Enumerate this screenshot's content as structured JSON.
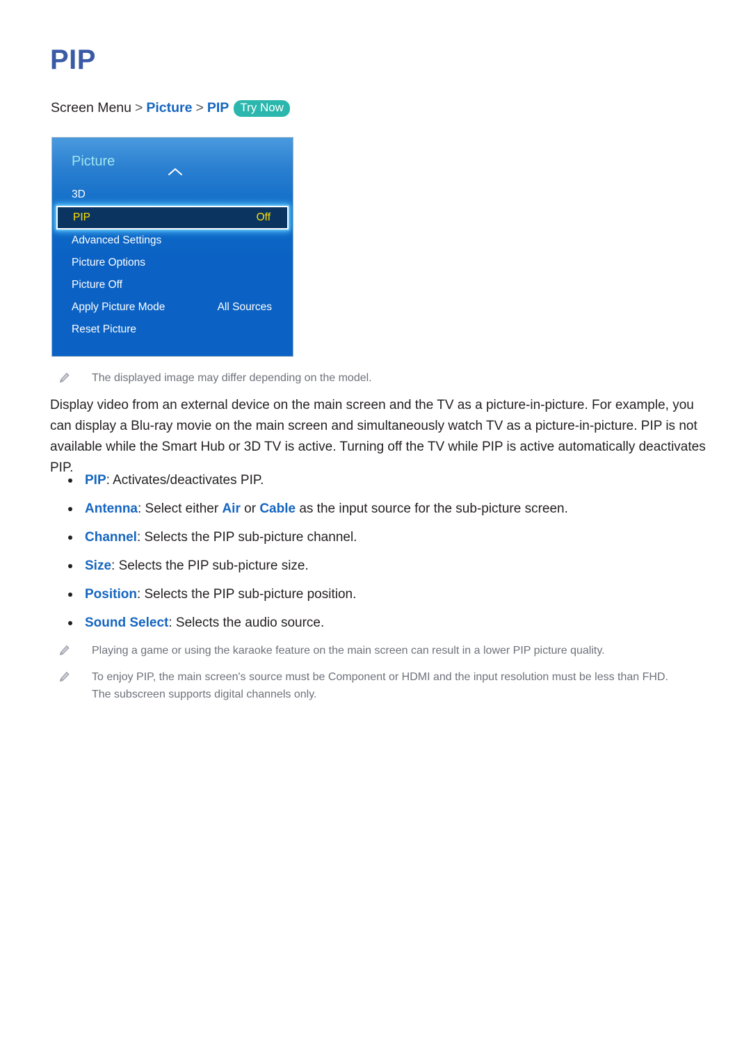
{
  "page": {
    "title": "PIP"
  },
  "breadcrumb": {
    "root": "Screen Menu",
    "separator": ">",
    "level1": "Picture",
    "level2": "PIP",
    "badge": "Try Now",
    "badge_color": "#2bb7ad",
    "link_color": "#1565c0"
  },
  "tv_menu": {
    "header": "Picture",
    "chevron_icon": "chevron-up-icon",
    "panel_color": "#0b62c4",
    "header_color": "#9fe6ef",
    "selected_bg": "#0b3560",
    "selected_text_color": "#ffe000",
    "rows": [
      {
        "label": "3D",
        "value": "",
        "selected": false
      },
      {
        "label": "PIP",
        "value": "Off",
        "selected": true
      },
      {
        "label": "Advanced Settings",
        "value": "",
        "selected": false
      },
      {
        "label": "Picture Options",
        "value": "",
        "selected": false
      },
      {
        "label": "Picture Off",
        "value": "",
        "selected": false
      },
      {
        "label": "Apply Picture Mode",
        "value": "All Sources",
        "selected": false
      },
      {
        "label": "Reset Picture",
        "value": "",
        "selected": false
      }
    ]
  },
  "notes": {
    "model_note": "The displayed image may differ depending on the model.",
    "footnote_1": "Playing a game or using the karaoke feature on the main screen can result in a lower PIP picture quality.",
    "footnote_2": "To enjoy PIP, the main screen's source must be Component or HDMI and the input resolution must be less than FHD. The subscreen supports digital channels only."
  },
  "body": {
    "paragraph": "Display video from an external device on the main screen and the TV as a picture-in-picture. For example, you can display a Blu-ray movie on the main screen and simultaneously watch TV as a picture-in-picture. PIP is not available while the Smart Hub or 3D TV is active. Turning off the TV while PIP is active automatically deactivates PIP."
  },
  "bullets": [
    {
      "term": "PIP",
      "after_term": ": Activates/deactivates PIP.",
      "mid1": "",
      "em1": "",
      "mid2": "",
      "em2": "",
      "tail": ""
    },
    {
      "term": "Antenna",
      "after_term": "",
      "mid1": ": Select either ",
      "em1": "Air",
      "mid2": " or ",
      "em2": "Cable",
      "tail": " as the input source for the sub-picture screen."
    },
    {
      "term": "Channel",
      "after_term": ": Selects the PIP sub-picture channel.",
      "mid1": "",
      "em1": "",
      "mid2": "",
      "em2": "",
      "tail": ""
    },
    {
      "term": "Size",
      "after_term": ": Selects the PIP sub-picture size.",
      "mid1": "",
      "em1": "",
      "mid2": "",
      "em2": "",
      "tail": ""
    },
    {
      "term": "Position",
      "after_term": ": Selects the PIP sub-picture position.",
      "mid1": "",
      "em1": "",
      "mid2": "",
      "em2": "",
      "tail": ""
    },
    {
      "term": "Sound Select",
      "after_term": ": Selects the audio source.",
      "mid1": "",
      "em1": "",
      "mid2": "",
      "em2": "",
      "tail": ""
    }
  ]
}
